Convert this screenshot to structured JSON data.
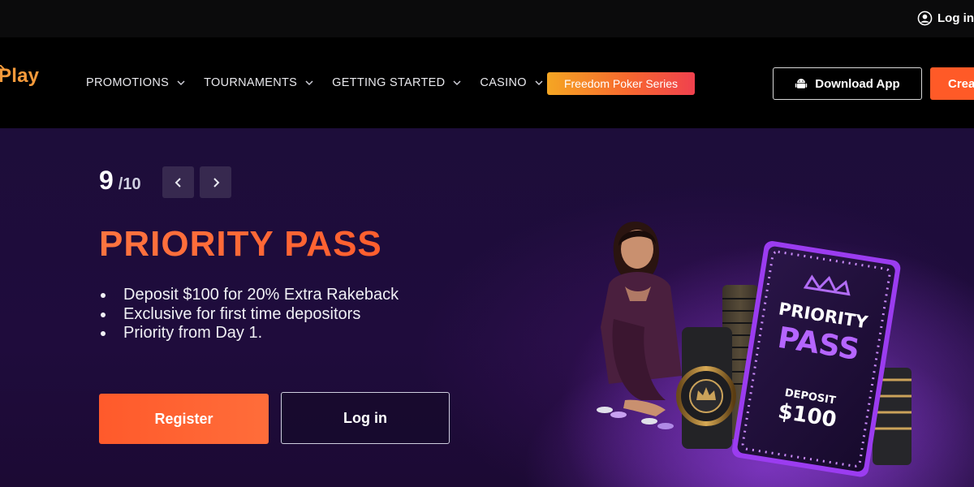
{
  "topbar": {
    "login_label": "Log in"
  },
  "navbar": {
    "logo_text": "Play",
    "items": [
      {
        "label": "PROMOTIONS"
      },
      {
        "label": "TOURNAMENTS"
      },
      {
        "label": "GETTING STARTED"
      },
      {
        "label": "CASINO"
      }
    ],
    "highlight_label": "Freedom Poker Series",
    "download_label": "Download App",
    "create_label": "Create"
  },
  "carousel": {
    "current": "9",
    "total": "/10"
  },
  "hero": {
    "title": "PRIORITY PASS",
    "bullets": [
      "Deposit $100 for 20% Extra Rakeback",
      "Exclusive for first time depositors",
      "Priority from Day 1."
    ],
    "register_label": "Register",
    "login_label": "Log in",
    "card": {
      "line1": "PRIORITY",
      "line2": "PASS",
      "deposit_label": "DEPOSIT",
      "deposit_amount": "$100"
    }
  },
  "icons": {
    "user": "user-circle-icon",
    "chevron": "chevron-down-icon",
    "android": "android-icon",
    "prev": "chevron-left-icon",
    "next": "chevron-right-icon",
    "crown": "crown-icon"
  },
  "colors": {
    "accent": "#ff5a27",
    "title": "#ff6a35",
    "hero_bg": "#1e0c3a",
    "gradient_start": "#f5a623",
    "gradient_end": "#f0414e",
    "card_purple": "#9b3cf0"
  }
}
